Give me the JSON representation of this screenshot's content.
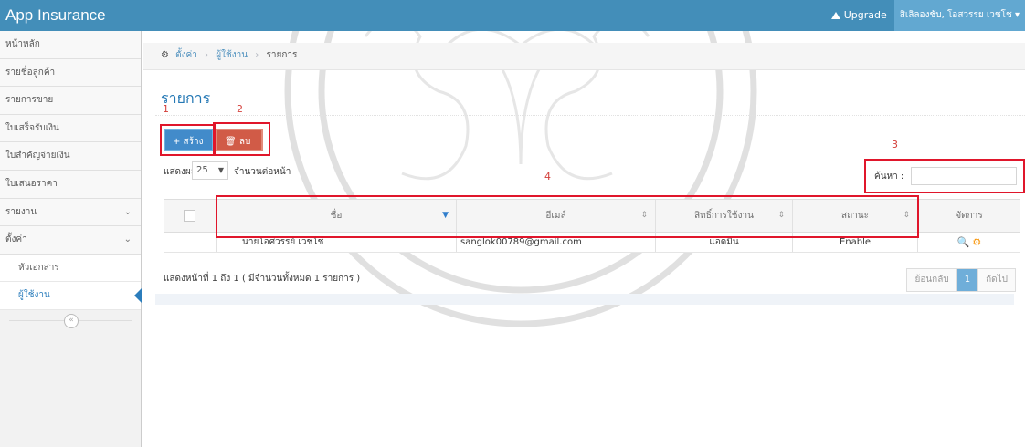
{
  "app": {
    "title": "App Insurance"
  },
  "navbar": {
    "upgrade_label": "Upgrade",
    "user_label": "สิเลิลองชับ, โอสวรรย เวชโช ▾"
  },
  "sidebar": {
    "items": [
      {
        "label": "หน้าหลัก"
      },
      {
        "label": "รายชื่อลูกค้า"
      },
      {
        "label": "รายการขาย"
      },
      {
        "label": "ใบเสร็จรับเงิน"
      },
      {
        "label": "ใบสำคัญจ่ายเงิน"
      },
      {
        "label": "ใบเสนอราคา"
      },
      {
        "label": "รายงาน",
        "chevron": "⌄"
      },
      {
        "label": "ตั้งค่า",
        "chevron": "⌄"
      }
    ],
    "subitems": [
      {
        "label": "หัวเอกสาร"
      },
      {
        "label": "ผู้ใช้งาน"
      }
    ],
    "collapse_icon": "«"
  },
  "breadcrumbs": {
    "home": "ตั้งค่า",
    "level2": "ผู้ใช้งาน",
    "current": "รายการ",
    "sep": "›"
  },
  "page": {
    "title": "รายการ"
  },
  "annotations": {
    "n1": "1",
    "n2": "2",
    "n3": "3",
    "n4": "4"
  },
  "toolbar": {
    "create_label": "+ สร้าง",
    "delete_label": "🗑 ลบ"
  },
  "table_controls": {
    "show_prefix": "แสดงผล",
    "page_size": "25",
    "show_suffix": "จำนวนต่อหน้า",
    "search_label": "ค้นหา :",
    "search_value": ""
  },
  "table": {
    "columns": [
      "ชื่อ",
      "อีเมล์",
      "สิทธิ์การใช้งาน",
      "สถานะ",
      "จัดการ"
    ],
    "rows": [
      {
        "name": "นายโอศวรรย์ เวชโช",
        "email": "sanglok00789@gmail.com",
        "role": "แอดมิน",
        "status": "Enable"
      }
    ],
    "info": "แสดงหน้าที่ 1 ถึง 1 ( มีจำนวนทั้งหมด 1 รายการ )"
  },
  "pager": {
    "prev": "ย้อนกลับ",
    "current": "1",
    "next": "ถัดไป"
  },
  "colors": {
    "navbar": "#438eb9",
    "accent": "#2679b5",
    "annotation": "#e0162b"
  }
}
